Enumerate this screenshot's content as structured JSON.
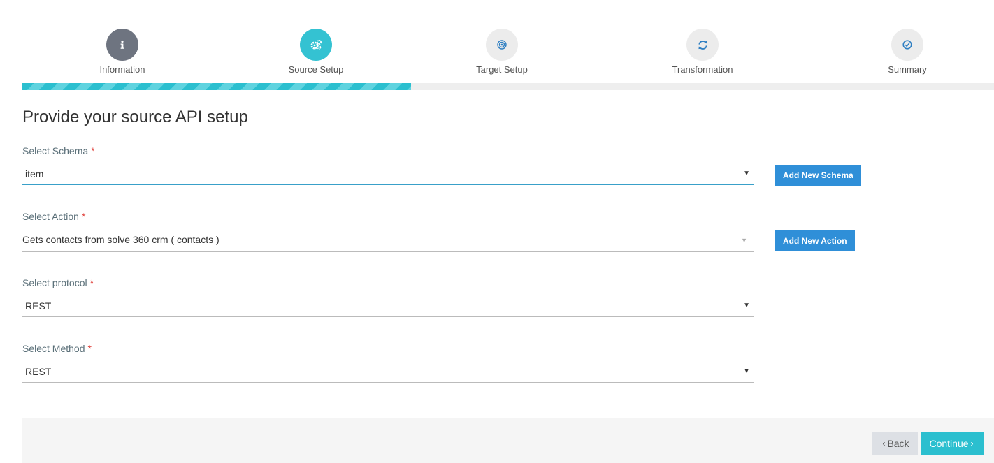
{
  "stepper": {
    "steps": [
      {
        "label": "Information",
        "icon": "info-icon",
        "state": "done"
      },
      {
        "label": "Source Setup",
        "icon": "gears-icon",
        "state": "active"
      },
      {
        "label": "Target Setup",
        "icon": "target-icon",
        "state": "pending"
      },
      {
        "label": "Transformation",
        "icon": "refresh-icon",
        "state": "pending"
      },
      {
        "label": "Summary",
        "icon": "check-circle-icon",
        "state": "pending"
      }
    ],
    "progress": 0.4
  },
  "colors": {
    "accent": "#34c2d2",
    "done_step": "#6e7480",
    "primary_button": "#2f8fd8",
    "required": "#e0413b",
    "icon_blue": "#2f7fc2"
  },
  "form": {
    "heading": "Provide your source API setup",
    "required_marker": "*",
    "schema": {
      "label": "Select Schema",
      "value": "item",
      "button": "Add New Schema"
    },
    "action": {
      "label": "Select Action",
      "value": "Gets contacts from solve 360 crm ( contacts )",
      "button": "Add New Action"
    },
    "protocol": {
      "label": "Select protocol",
      "value": "REST"
    },
    "method": {
      "label": "Select Method",
      "value": "REST"
    }
  },
  "footer": {
    "back_label": "Back",
    "continue_label": "Continue"
  }
}
